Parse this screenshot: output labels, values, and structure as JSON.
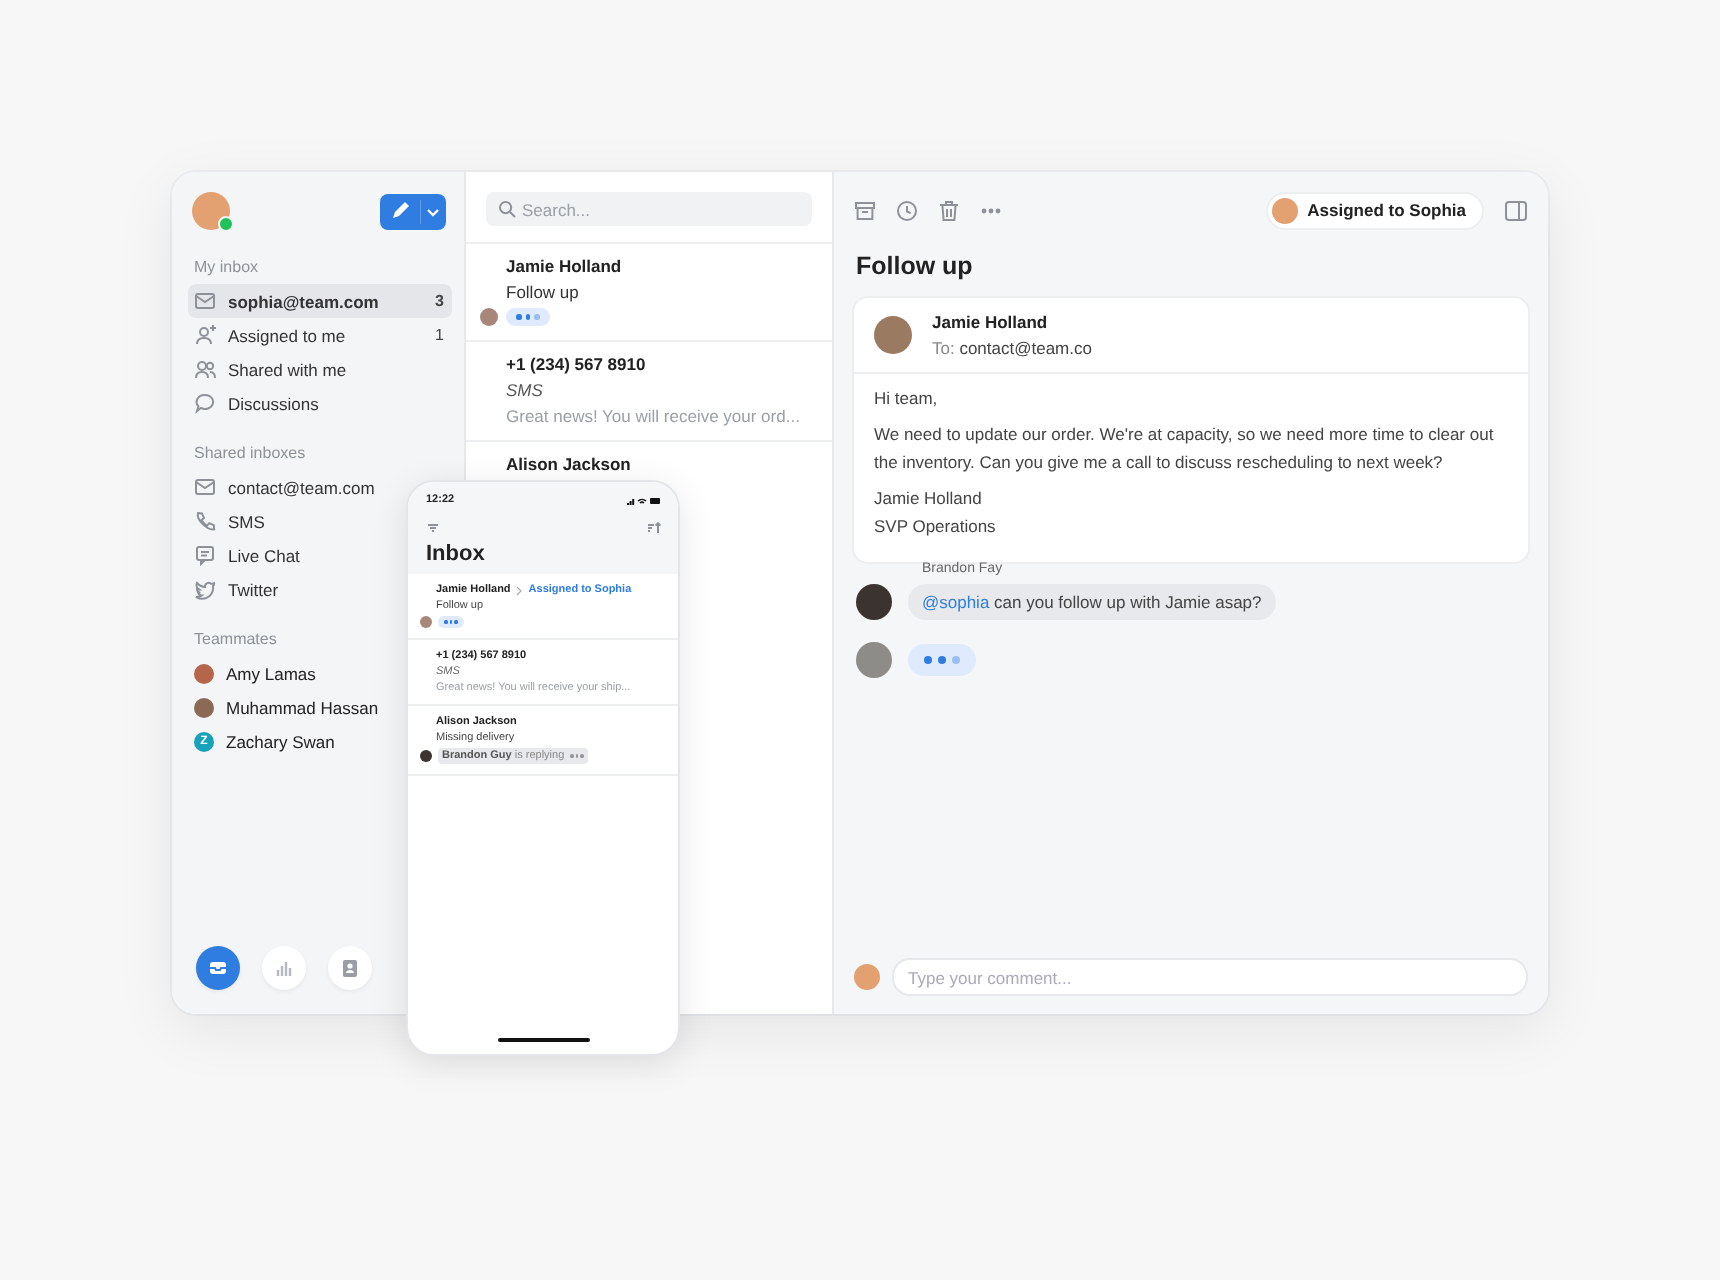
{
  "sidebar": {
    "user": {
      "online": true
    },
    "sections": [
      {
        "title": "My inbox",
        "items": [
          {
            "kind": "mail",
            "label": "sophia@team.com",
            "count": "3",
            "selected": true
          },
          {
            "kind": "assign",
            "label": "Assigned to me",
            "count": "1",
            "selected": false
          },
          {
            "kind": "shared",
            "label": "Shared with me",
            "selected": false
          },
          {
            "kind": "discussion",
            "label": "Discussions",
            "selected": false
          }
        ]
      },
      {
        "title": "Shared inboxes",
        "items": [
          {
            "kind": "mail",
            "label": "contact@team.com",
            "selected": false
          },
          {
            "kind": "phone",
            "label": "SMS",
            "selected": false
          },
          {
            "kind": "chat",
            "label": "Live Chat",
            "selected": false
          },
          {
            "kind": "twitter",
            "label": "Twitter",
            "selected": false
          }
        ]
      }
    ],
    "teammates": {
      "title": "Teammates",
      "items": [
        {
          "kind": "photo",
          "label": "Amy Lamas",
          "color": "#b5654a"
        },
        {
          "kind": "photo",
          "label": "Muhammad Hassan",
          "color": "#8a6a55"
        },
        {
          "kind": "initial",
          "initial": "Z",
          "label": "Zachary Swan",
          "color": "#17a2b8"
        }
      ]
    },
    "nav": [
      {
        "kind": "inbox",
        "selected": true
      },
      {
        "kind": "chart",
        "selected": false
      },
      {
        "kind": "contact",
        "selected": false
      }
    ]
  },
  "list": {
    "search": {
      "placeholder": "Search..."
    },
    "conversations": [
      {
        "name": "Jamie Holland",
        "subject": "Follow up",
        "typing": true
      },
      {
        "name": "+1 (234) 567 8910",
        "subject": "SMS",
        "subject_italic": true,
        "preview": "Great news! You will receive your ord..."
      },
      {
        "name": "Alison Jackson"
      }
    ]
  },
  "detail": {
    "assignee": "Assigned to Sophia",
    "title": "Follow up",
    "message": {
      "from": "Jamie Holland",
      "to_label": "To:",
      "to": "contact@team.co",
      "body": [
        "Hi team,",
        "We need to update our order. We're at capacity, so we need more time to clear out the inventory. Can you give me a call to discuss rescheduling to next week?",
        "Jamie Holland\nSVP Operations"
      ]
    },
    "comments": [
      {
        "kind": "text",
        "author": "Brandon Fay",
        "mention": "@sophia",
        "text": " can you follow up with Jamie asap?"
      },
      {
        "kind": "typing"
      }
    ],
    "composer": {
      "placeholder": "Type your comment..."
    }
  },
  "phone": {
    "time": "12:22",
    "title": "Inbox",
    "items": [
      {
        "name": "Jamie Holland",
        "assignee": "Assigned to Sophia",
        "subject": "Follow up",
        "typing": true
      },
      {
        "name": "+1 (234) 567 8910",
        "subject": "SMS",
        "subject_italic": true,
        "preview": "Great news! You will receive your ship..."
      },
      {
        "name": "Alison Jackson",
        "subject": "Missing delivery",
        "replying": "**Brandon Guy** is replying"
      }
    ]
  }
}
